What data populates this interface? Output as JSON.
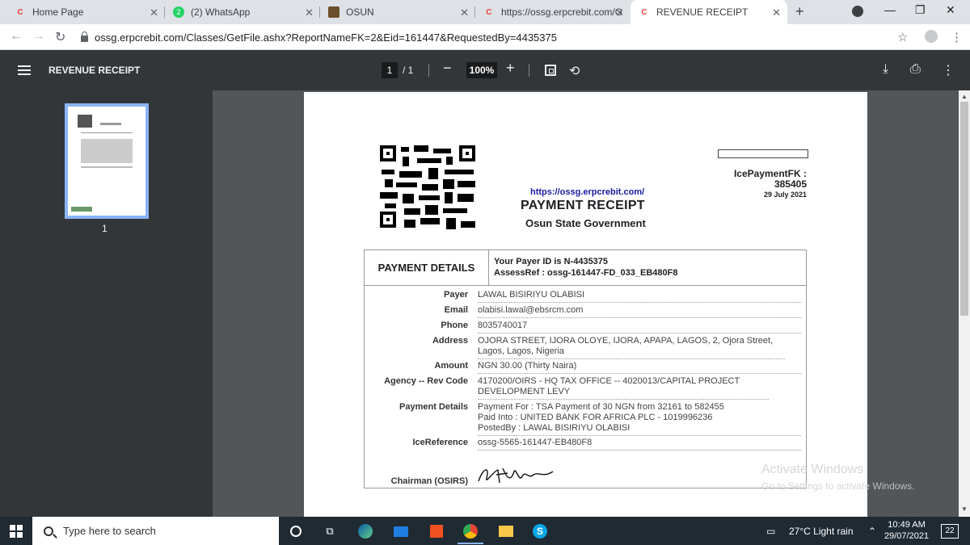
{
  "browser": {
    "tabs": [
      {
        "title": "Home Page",
        "icon": "erpc-icon",
        "active": false
      },
      {
        "title": "(2) WhatsApp",
        "icon": "whatsapp-icon",
        "active": false
      },
      {
        "title": "OSUN",
        "icon": "osun-icon",
        "active": false
      },
      {
        "title": "https://ossg.erpcrebit.com/G",
        "icon": "erpc-icon",
        "active": false
      },
      {
        "title": "REVENUE RECEIPT",
        "icon": "erpc-icon",
        "active": true
      }
    ],
    "url": "ossg.erpcrebit.com/Classes/GetFile.ashx?ReportNameFK=2&Eid=161447&RequestedBy=4435375"
  },
  "pdf_viewer": {
    "title": "REVENUE RECEIPT",
    "page_current": "1",
    "page_total": "/ 1",
    "zoom": "100%",
    "thumb_number": "1"
  },
  "receipt": {
    "link": "https://ossg.erpcrebit.com/",
    "title": "PAYMENT RECEIPT",
    "government": "Osun State Government",
    "ice_label": "IcePaymentFK :",
    "ice_value": "385405",
    "date": "29 July 2021",
    "details_header": "PAYMENT DETAILS",
    "payer_id_line": "Your Payer ID is  N-4435375",
    "assess_ref_line": "AssessRef :  ossg-161447-FD_033_EB480F8",
    "rows": [
      {
        "label": "Payer",
        "value": "LAWAL BISIRIYU OLABISI"
      },
      {
        "label": "Email",
        "value": "olabisi.lawal@ebsrcm.com"
      },
      {
        "label": "Phone",
        "value": "8035740017"
      },
      {
        "label": "Address",
        "value": "OJORA STREET, IJORA OLOYE, IJORA, APAPA, LAGOS, 2, Ojora Street, Lagos, Lagos, Nigeria"
      },
      {
        "label": "Amount",
        "value": "NGN 30.00 (Thirty Naira)"
      },
      {
        "label": "Agency -- Rev Code",
        "value": "4170200/OIRS - HQ TAX OFFICE -- 4020013/CAPITAL PROJECT DEVELOPMENT LEVY"
      },
      {
        "label": "Payment Details",
        "value": "Payment For : TSA Payment of 30 NGN from 32161 to 582455\nPaid Into : UNITED BANK FOR AFRICA PLC - 1019996236\nPostedBy : LAWAL BISIRIYU OLABISI"
      },
      {
        "label": "IceReference",
        "value": "ossg-5565-161447-EB480F8"
      }
    ],
    "signatory": "Chairman (OSIRS)"
  },
  "watermark": {
    "title": "Activate Windows",
    "subtitle": "Go to Settings to activate Windows."
  },
  "taskbar": {
    "search_placeholder": "Type here to search",
    "weather": "27°C  Light rain",
    "time": "10:49 AM",
    "date": "29/07/2021",
    "notifications": "22"
  }
}
